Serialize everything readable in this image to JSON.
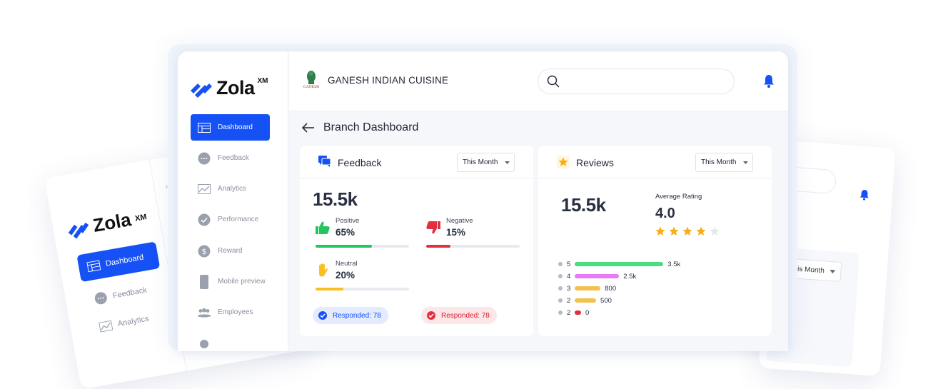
{
  "brand": {
    "logo_text": "Zola",
    "logo_sup": "XM"
  },
  "sidebar": {
    "items": [
      {
        "label": "Dashboard",
        "icon": "dashboard-icon"
      },
      {
        "label": "Feedback",
        "icon": "chat-icon"
      },
      {
        "label": "Analytics",
        "icon": "chart-icon"
      },
      {
        "label": "Performance",
        "icon": "check-icon"
      },
      {
        "label": "Reward",
        "icon": "dollar-icon"
      },
      {
        "label": "Mobile preview",
        "icon": "phone-icon"
      },
      {
        "label": "Employees",
        "icon": "people-icon"
      }
    ]
  },
  "topbar": {
    "restaurant_name": "GANESH INDIAN CUISINE",
    "logo_caption": "GANESH",
    "search_placeholder": ""
  },
  "page": {
    "title": "Branch Dashboard"
  },
  "feedback_card": {
    "title": "Feedback",
    "period": "This Month",
    "total": "15.5k",
    "positive": {
      "label": "Positive",
      "value": "65%",
      "fraction": 0.6
    },
    "negative": {
      "label": "Negative",
      "value": "15%",
      "fraction": 0.26
    },
    "neutral": {
      "label": "Neutral",
      "value": "20%",
      "fraction": 0.3
    },
    "responded_positive": "Responded: 78",
    "responded_negative": "Responded: 78"
  },
  "reviews_card": {
    "title": "Reviews",
    "period": "This Month",
    "total": "15.5k",
    "avg_label": "Average Rating",
    "avg_value": "4.0",
    "star_rating": 4,
    "distribution": [
      {
        "star": "5",
        "count": "3.5k",
        "fraction": 1.0,
        "color": "#4ade80"
      },
      {
        "star": "4",
        "count": "2.5k",
        "fraction": 0.5,
        "color": "#e879f9"
      },
      {
        "star": "3",
        "count": "800",
        "fraction": 0.29,
        "color": "#f2c14e"
      },
      {
        "star": "2",
        "count": "500",
        "fraction": 0.24,
        "color": "#f2c14e"
      },
      {
        "star": "2",
        "count": "0",
        "fraction": 0.07,
        "color": "#e0313d"
      }
    ]
  },
  "colors": {
    "primary": "#1651f5",
    "positive": "#22c55e",
    "negative": "#e0313d",
    "neutral": "#fbbf24"
  }
}
